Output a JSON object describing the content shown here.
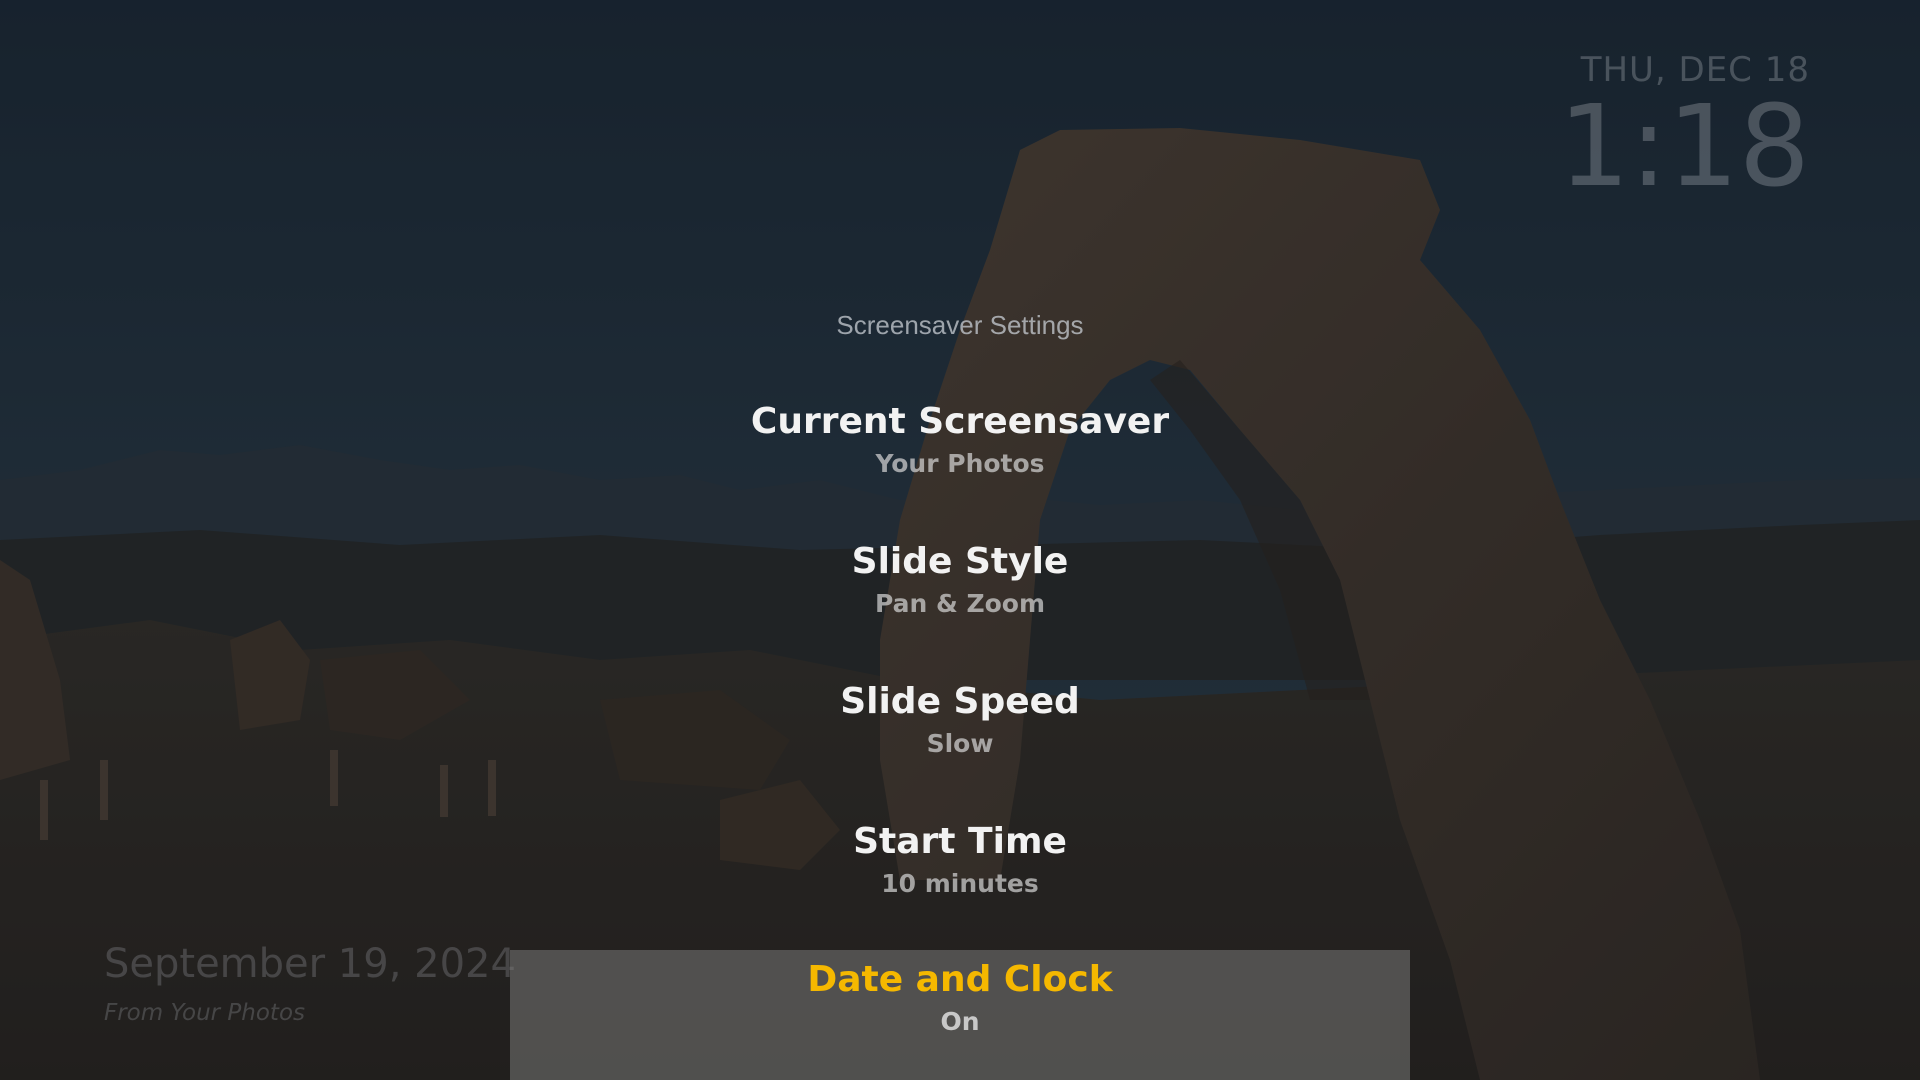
{
  "clock": {
    "date": "THU, DEC 18",
    "time": "1:18"
  },
  "photo_info": {
    "date": "September 19, 2024",
    "source": "From Your Photos"
  },
  "settings": {
    "title": "Screensaver Settings",
    "items": [
      {
        "label": "Current Screensaver",
        "value": "Your Photos"
      },
      {
        "label": "Slide Style",
        "value": "Pan & Zoom"
      },
      {
        "label": "Slide Speed",
        "value": "Slow"
      },
      {
        "label": "Start Time",
        "value": "10 minutes"
      },
      {
        "label": "Date and Clock",
        "value": "On",
        "selected": true
      }
    ]
  },
  "colors": {
    "selected_label": "#f5b800",
    "item_label": "#f2f2f2",
    "highlight_bg": "#6f6f6d"
  },
  "background": {
    "icon": "desert-arch-photo"
  }
}
